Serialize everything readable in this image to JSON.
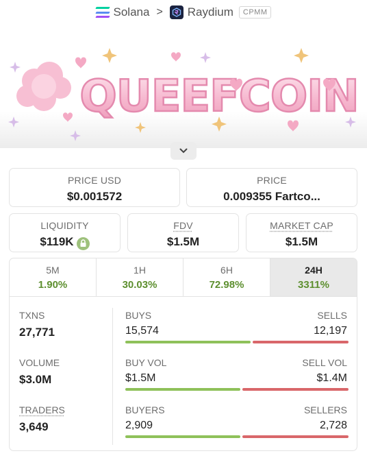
{
  "breadcrumb": {
    "chain": "Solana",
    "dex": "Raydium",
    "pool_type": "CPMM"
  },
  "banner": {
    "title": "QUEEFCOIN"
  },
  "price": {
    "usd_label": "PRICE USD",
    "usd_value": "$0.001572",
    "native_label": "PRICE",
    "native_value": "0.009355 Fartco..."
  },
  "metrics": {
    "liquidity_label": "LIQUIDITY",
    "liquidity_value": "$119K",
    "fdv_label": "FDV",
    "fdv_value": "$1.5M",
    "mcap_label": "MARKET CAP",
    "mcap_value": "$1.5M"
  },
  "timeframes": [
    {
      "label": "5M",
      "change": "1.90%"
    },
    {
      "label": "1H",
      "change": "30.03%"
    },
    {
      "label": "6H",
      "change": "72.98%"
    },
    {
      "label": "24H",
      "change": "3311%"
    }
  ],
  "active_timeframe": "24H",
  "stats": {
    "txns_label": "TXNS",
    "txns_value": "27,771",
    "volume_label": "VOLUME",
    "volume_value": "$3.0M",
    "traders_label": "TRADERS",
    "traders_value": "3,649",
    "buys_label": "BUYS",
    "buys_value": "15,574",
    "sells_label": "SELLS",
    "sells_value": "12,197",
    "buy_vol_label": "BUY VOL",
    "buy_vol_value": "$1.5M",
    "sell_vol_label": "SELL VOL",
    "sell_vol_value": "$1.4M",
    "buyers_label": "BUYERS",
    "buyers_value": "2,909",
    "sellers_label": "SELLERS",
    "sellers_value": "2,728"
  },
  "colors": {
    "positive": "#5d8f2f",
    "buy_bar": "#8fc15a",
    "sell_bar": "#d9676a",
    "banner_pink": "#f6b8cf",
    "lock_green": "#9ec17c"
  },
  "icons": [
    "solana-icon",
    "raydium-icon",
    "chevron-right-icon",
    "chevron-down-icon",
    "lock-icon"
  ]
}
